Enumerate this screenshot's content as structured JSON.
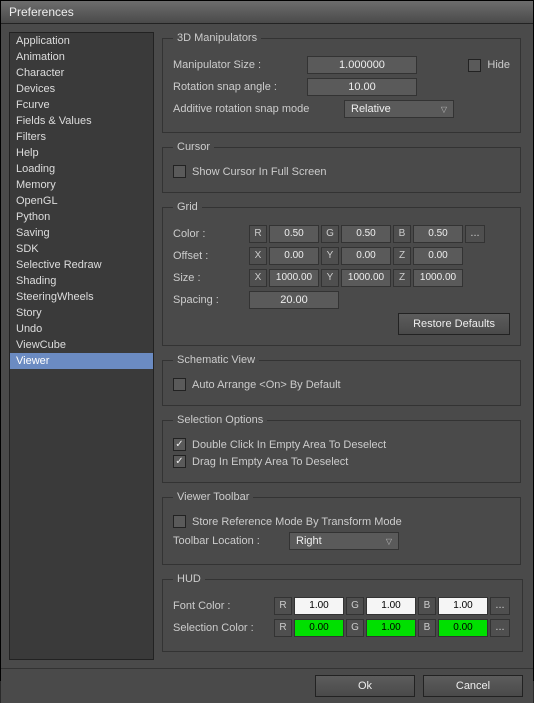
{
  "window": {
    "title": "Preferences"
  },
  "sidebar": {
    "items": [
      "Application",
      "Animation",
      "Character",
      "Devices",
      "Fcurve",
      "Fields & Values",
      "Filters",
      "Help",
      "Loading",
      "Memory",
      "OpenGL",
      "Python",
      "Saving",
      "SDK",
      "Selective Redraw",
      "Shading",
      "SteeringWheels",
      "Story",
      "Undo",
      "ViewCube",
      "Viewer"
    ],
    "selected": "Viewer"
  },
  "manip": {
    "legend": "3D Manipulators",
    "size_label": "Manipulator Size :",
    "size_value": "1.000000",
    "hide_label": "Hide",
    "rot_label": "Rotation snap angle :",
    "rot_value": "10.00",
    "add_label": "Additive rotation snap mode",
    "add_value": "Relative"
  },
  "cursor": {
    "legend": "Cursor",
    "show_label": "Show Cursor In Full Screen"
  },
  "grid": {
    "legend": "Grid",
    "color_label": "Color :",
    "color": {
      "r": "0.50",
      "g": "0.50",
      "b": "0.50"
    },
    "offset_label": "Offset :",
    "offset": {
      "x": "0.00",
      "y": "0.00",
      "z": "0.00"
    },
    "size_label": "Size :",
    "size": {
      "x": "1000.00",
      "y": "1000.00",
      "z": "1000.00"
    },
    "spacing_label": "Spacing :",
    "spacing_value": "20.00",
    "restore_label": "Restore Defaults"
  },
  "schem": {
    "legend": "Schematic View",
    "auto_label": "Auto Arrange <On> By Default"
  },
  "sel": {
    "legend": "Selection Options",
    "dbl_label": "Double Click In Empty Area To Deselect",
    "drag_label": "Drag In Empty Area To Deselect"
  },
  "toolbar": {
    "legend": "Viewer Toolbar",
    "store_label": "Store Reference Mode By Transform Mode",
    "loc_label": "Toolbar Location :",
    "loc_value": "Right"
  },
  "hud": {
    "legend": "HUD",
    "font_label": "Font Color :",
    "font": {
      "r": "1.00",
      "g": "1.00",
      "b": "1.00"
    },
    "sel_label": "Selection Color :",
    "selc": {
      "r": "0.00",
      "g": "1.00",
      "b": "0.00"
    }
  },
  "buttons": {
    "ok": "Ok",
    "cancel": "Cancel"
  },
  "axis": {
    "r": "R",
    "g": "G",
    "b": "B",
    "x": "X",
    "y": "Y",
    "z": "Z",
    "more": "..."
  }
}
